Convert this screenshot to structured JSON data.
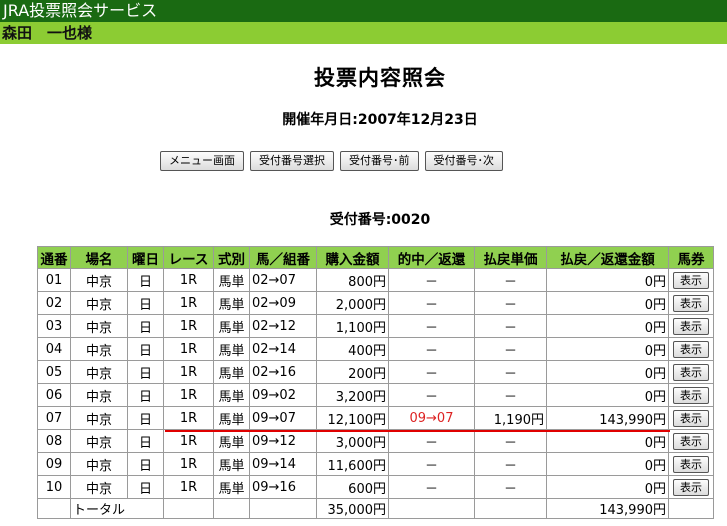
{
  "window": {
    "title": "JRA投票照会サービス"
  },
  "user": {
    "name": "森田　一也様"
  },
  "page": {
    "title": "投票内容照会",
    "date_line": "開催年月日:2007年12月23日"
  },
  "buttons": {
    "menu": "メニュー画面",
    "select": "受付番号選択",
    "prev": "受付番号･前",
    "next": "受付番号･次"
  },
  "receipt": {
    "line": "受付番号:0020"
  },
  "table": {
    "headers": [
      "通番",
      "場名",
      "曜日",
      "レース",
      "式別",
      "馬／組番",
      "購入金額",
      "的中／返還",
      "払戻単価",
      "払戻／返還金額",
      "馬券"
    ],
    "show_label": "表示",
    "rows": [
      {
        "no": "01",
        "place": "中京",
        "day": "日",
        "race": "1R",
        "type": "馬単",
        "combo": "02→07",
        "amount": "800円",
        "hit": "－",
        "unit": "－",
        "payout": "0円"
      },
      {
        "no": "02",
        "place": "中京",
        "day": "日",
        "race": "1R",
        "type": "馬単",
        "combo": "02→09",
        "amount": "2,000円",
        "hit": "－",
        "unit": "－",
        "payout": "0円"
      },
      {
        "no": "03",
        "place": "中京",
        "day": "日",
        "race": "1R",
        "type": "馬単",
        "combo": "02→12",
        "amount": "1,100円",
        "hit": "－",
        "unit": "－",
        "payout": "0円"
      },
      {
        "no": "04",
        "place": "中京",
        "day": "日",
        "race": "1R",
        "type": "馬単",
        "combo": "02→14",
        "amount": "400円",
        "hit": "－",
        "unit": "－",
        "payout": "0円"
      },
      {
        "no": "05",
        "place": "中京",
        "day": "日",
        "race": "1R",
        "type": "馬単",
        "combo": "02→16",
        "amount": "200円",
        "hit": "－",
        "unit": "－",
        "payout": "0円"
      },
      {
        "no": "06",
        "place": "中京",
        "day": "日",
        "race": "1R",
        "type": "馬単",
        "combo": "09→02",
        "amount": "3,200円",
        "hit": "－",
        "unit": "－",
        "payout": "0円"
      },
      {
        "no": "07",
        "place": "中京",
        "day": "日",
        "race": "1R",
        "type": "馬単",
        "combo": "09→07",
        "amount": "12,100円",
        "hit": "09→07",
        "unit": "1,190円",
        "payout": "143,990円"
      },
      {
        "no": "08",
        "place": "中京",
        "day": "日",
        "race": "1R",
        "type": "馬単",
        "combo": "09→12",
        "amount": "3,000円",
        "hit": "－",
        "unit": "－",
        "payout": "0円"
      },
      {
        "no": "09",
        "place": "中京",
        "day": "日",
        "race": "1R",
        "type": "馬単",
        "combo": "09→14",
        "amount": "11,600円",
        "hit": "－",
        "unit": "－",
        "payout": "0円"
      },
      {
        "no": "10",
        "place": "中京",
        "day": "日",
        "race": "1R",
        "type": "馬単",
        "combo": "09→16",
        "amount": "600円",
        "hit": "－",
        "unit": "－",
        "payout": "0円"
      }
    ],
    "total": {
      "label": "トータル",
      "amount": "35,000円",
      "payout": "143,990円"
    }
  }
}
